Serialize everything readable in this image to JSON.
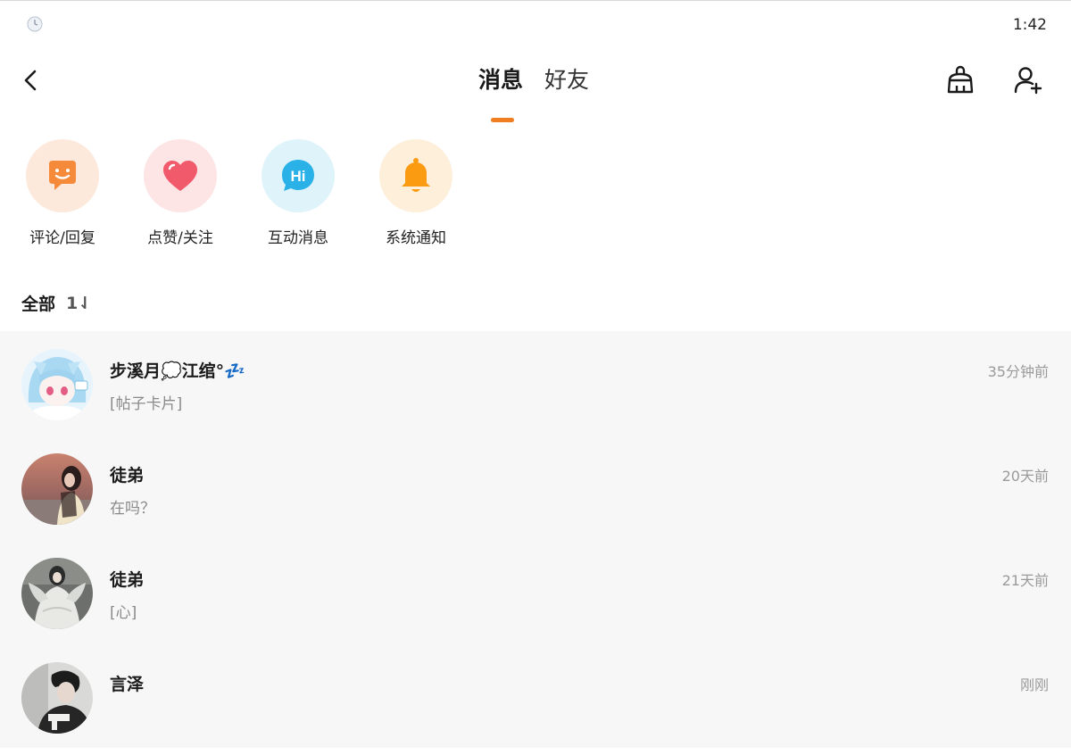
{
  "status_bar": {
    "time": "1:42",
    "icon": "clock-icon"
  },
  "nav": {
    "back_icon": "chevron-left-icon",
    "tabs": [
      {
        "label": "消息",
        "active": true
      },
      {
        "label": "好友",
        "active": false
      }
    ],
    "actions": [
      {
        "icon": "broom-icon"
      },
      {
        "icon": "add-user-icon"
      }
    ],
    "accent_color": "#f07d1f"
  },
  "shortcuts": [
    {
      "label": "评论/回复",
      "icon": "smile-chat-icon",
      "bg_color": "#fde9dc",
      "icon_color": "#f58b3a"
    },
    {
      "label": "点赞/关注",
      "icon": "heart-icon",
      "bg_color": "#fde5e5",
      "icon_color": "#f15a6a"
    },
    {
      "label": "互动消息",
      "icon": "hi-bubble-icon",
      "bg_color": "#dff3fb",
      "icon_color": "#2ab2e8"
    },
    {
      "label": "系统通知",
      "icon": "bell-icon",
      "bg_color": "#fdefd9",
      "icon_color": "#fb9b12"
    }
  ],
  "filter": {
    "label": "全部",
    "sort_icon": "1⇃"
  },
  "messages": [
    {
      "name": "步溪月💭江绾°💤",
      "preview": "[帖子卡片]",
      "time": "35分钟前",
      "avatar": "anime-avatar"
    },
    {
      "name": "徒弟",
      "preview": "在吗？",
      "time": "20天前",
      "avatar": "sunset-girl-avatar"
    },
    {
      "name": "徒弟",
      "preview": "[心]",
      "time": "21天前",
      "avatar": "white-dress-avatar"
    },
    {
      "name": "言泽",
      "preview": "",
      "time": "刚刚",
      "avatar": "boy-avatar"
    }
  ]
}
